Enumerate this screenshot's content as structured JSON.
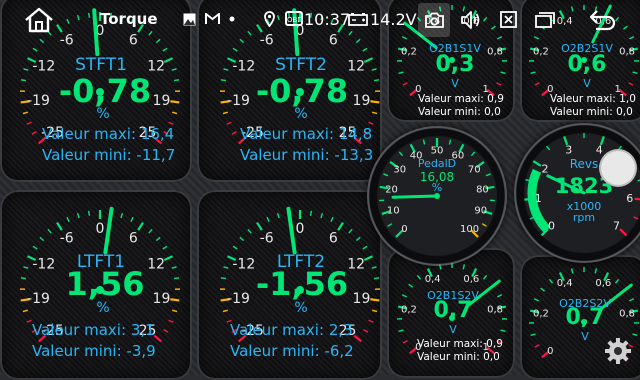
{
  "app": {
    "title": "Torque"
  },
  "status_bar": {
    "time": "10:37",
    "obd_label": "OBD",
    "battery_voltage": "14.2V",
    "icons": [
      "home-icon",
      "image-icon",
      "gmail-icon",
      "dot-icon",
      "location-icon",
      "obd-icon",
      "battery-icon",
      "screenshot-icon",
      "volume-icon",
      "close-icon",
      "window-icon",
      "back-icon"
    ]
  },
  "large_gauges": [
    {
      "id": "stft1",
      "name": "STFT1",
      "value": "-0,78",
      "unit": "%",
      "ticks": [
        "-25",
        "-19",
        "-12",
        "-6",
        "0",
        "6",
        "12",
        "19",
        "25"
      ],
      "max_label": "Valeur maxi:",
      "max_value": "16,4",
      "min_label": "Valeur mini:",
      "min_value": "-11,7",
      "needle": -0.78,
      "range": [
        -25,
        25
      ]
    },
    {
      "id": "stft2",
      "name": "STFT2",
      "value": "-0,78",
      "unit": "%",
      "ticks": [
        "-25",
        "-19",
        "-12",
        "-6",
        "0",
        "6",
        "12",
        "19",
        "25"
      ],
      "max_label": "Valeur maxi:",
      "max_value": "14,8",
      "min_label": "Valeur mini:",
      "min_value": "-13,3",
      "needle": -0.78,
      "range": [
        -25,
        25
      ]
    },
    {
      "id": "ltft1",
      "name": "LTFT1",
      "value": "1,56",
      "unit": "%",
      "ticks": [
        "-25",
        "-19",
        "-12",
        "-6",
        "0",
        "6",
        "12",
        "19",
        "25"
      ],
      "max_label": "Valeur maxi:",
      "max_value": "3,1",
      "min_label": "Valeur mini:",
      "min_value": "-3,9",
      "needle": 1.56,
      "range": [
        -25,
        25
      ]
    },
    {
      "id": "ltft2",
      "name": "LTFT2",
      "value": "-1,56",
      "unit": "%",
      "ticks": [
        "-25",
        "-19",
        "-12",
        "-6",
        "0",
        "6",
        "12",
        "19",
        "25"
      ],
      "max_label": "Valeur maxi:",
      "max_value": "2,3",
      "min_label": "Valeur mini:",
      "min_value": "-6,2",
      "needle": -1.56,
      "range": [
        -25,
        25
      ]
    }
  ],
  "o2_gauges": [
    {
      "id": "o2b1s1",
      "name": "O2B1S1V",
      "value": "0,3",
      "unit": "V",
      "ticks": [
        "0",
        "0,2",
        "0,4",
        "0,6",
        "0,8",
        "1"
      ],
      "max_label": "Valeur maxi:",
      "max_value": "0,9",
      "min_label": "Valeur mini:",
      "min_value": "0,0",
      "needle": 0.3
    },
    {
      "id": "o2b2s1",
      "name": "O2B2S1V",
      "value": "0,6",
      "unit": "V",
      "ticks": [
        "0",
        "0,2",
        "0,4",
        "0,6",
        "0,8",
        "1"
      ],
      "max_label": "Valeur maxi:",
      "max_value": "1,0",
      "min_label": "Valeur mini:",
      "min_value": "0,0",
      "needle": 0.6
    },
    {
      "id": "o2b1s2",
      "name": "O2B1S2V",
      "value": "0,7",
      "unit": "V",
      "ticks": [
        "0",
        "0,2",
        "0,4",
        "0,6",
        "0,8",
        "1"
      ],
      "max_label": "Valeur maxi:",
      "max_value": "0,9",
      "min_label": "Valeur mini:",
      "min_value": "0,0",
      "needle": 0.7
    },
    {
      "id": "o2b2s2",
      "name": "O2B2S2V",
      "value": "0,7",
      "unit": "V",
      "ticks": [
        "0",
        "0,2",
        "0,4",
        "0,6",
        "0,8",
        "1"
      ],
      "needle": 0.7
    }
  ],
  "pedal_gauge": {
    "name": "PedalD",
    "value": "16,08",
    "unit": "%",
    "ticks": [
      "0",
      "10",
      "20",
      "30",
      "40",
      "50",
      "60",
      "70",
      "80",
      "90",
      "100"
    ],
    "needle": 16.08
  },
  "revs_gauge": {
    "name": "Revs",
    "value": "1823",
    "unit_line1": "x1000",
    "unit_line2": "rpm",
    "ticks": [
      "0",
      "1",
      "2",
      "3",
      "4",
      "5",
      "6",
      "7"
    ],
    "needle": 1.823
  },
  "colors": {
    "needle": "#00e676",
    "value": "#00e676",
    "label": "#29b6f6",
    "warn": "#ffb300",
    "danger": "#ff1744"
  }
}
